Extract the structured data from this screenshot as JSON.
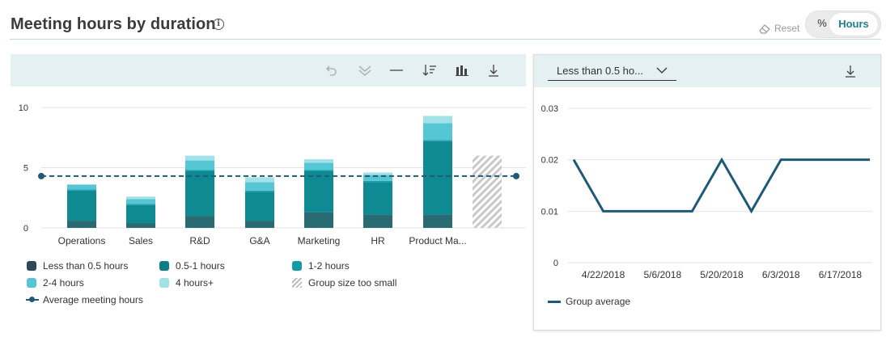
{
  "header": {
    "title": "Meeting hours by duration",
    "info_icon": "info-icon",
    "reset_label": "Reset",
    "toggle": {
      "percent_label": "%",
      "hours_label": "Hours",
      "selected": "Hours"
    }
  },
  "toolbar_left": {
    "icons": [
      "undo-icon",
      "drill-down-icon",
      "average-line-icon",
      "sort-icon",
      "chart-type-icon",
      "download-icon"
    ]
  },
  "toolbar_right": {
    "dropdown_value": "Less than 0.5 ho...",
    "icons": [
      "chevron-down-icon",
      "download-icon"
    ]
  },
  "colors": {
    "lt_0_5": "#2a6a72",
    "h0_5_1": "#0f8a93",
    "h1_2": "#159eac",
    "h2_4": "#56c6d4",
    "h4_plus": "#a2e1e8",
    "average_line": "#1e5a76",
    "group_line": "#1e5a76"
  },
  "legend_left": {
    "lt_0_5": "Less than 0.5 hours",
    "h0_5_1": "0.5-1 hours",
    "h1_2": "1-2 hours",
    "h2_4": "2-4 hours",
    "h4_plus": "4 hours+",
    "too_small": "Group size too small",
    "average": "Average meeting hours"
  },
  "legend_right": {
    "group_average": "Group average"
  },
  "chart_data": [
    {
      "type": "bar",
      "stacked": true,
      "categories": [
        "Operations",
        "Sales",
        "R&D",
        "G&A",
        "Marketing",
        "HR",
        "Product Ma..."
      ],
      "series": [
        {
          "name": "Less than 0.5 hours",
          "values": [
            0.6,
            0.4,
            1.0,
            0.6,
            1.3,
            1.1,
            1.1
          ]
        },
        {
          "name": "0.5-1 hours",
          "values": [
            2.5,
            1.5,
            3.7,
            2.4,
            3.4,
            2.7,
            6.1
          ]
        },
        {
          "name": "1-2 hours",
          "values": [
            0.1,
            0.1,
            0.1,
            0.1,
            0.1,
            0.1,
            0.1
          ]
        },
        {
          "name": "2-4 hours",
          "values": [
            0.4,
            0.4,
            0.8,
            0.7,
            0.6,
            0.5,
            1.4
          ]
        },
        {
          "name": "4 hours+",
          "values": [
            0.0,
            0.2,
            0.4,
            0.4,
            0.3,
            0.2,
            0.6
          ]
        }
      ],
      "too_small_group": {
        "label": "Group size too small",
        "value": 6.0
      },
      "average_line": {
        "label": "Average meeting hours",
        "value": 4.3
      },
      "yticks": [
        0,
        5,
        10
      ],
      "ylim": [
        0,
        10
      ],
      "grid": true,
      "legend": "bottom"
    },
    {
      "type": "line",
      "x": [
        "4/15/2018",
        "4/22/2018",
        "4/29/2018",
        "5/6/2018",
        "5/13/2018",
        "5/20/2018",
        "5/27/2018",
        "6/3/2018",
        "6/10/2018",
        "6/17/2018",
        "6/24/2018"
      ],
      "xtick_labels": [
        "4/22/2018",
        "5/6/2018",
        "5/20/2018",
        "6/3/2018",
        "6/17/2018"
      ],
      "series": [
        {
          "name": "Group average",
          "values": [
            0.02,
            0.01,
            0.01,
            0.01,
            0.01,
            0.02,
            0.01,
            0.02,
            0.02,
            0.02,
            0.02
          ]
        }
      ],
      "yticks": [
        "0",
        "0.01",
        "0.02",
        "0.03"
      ],
      "ylim": [
        0,
        0.03
      ],
      "grid": true,
      "legend": "bottom-left"
    }
  ]
}
